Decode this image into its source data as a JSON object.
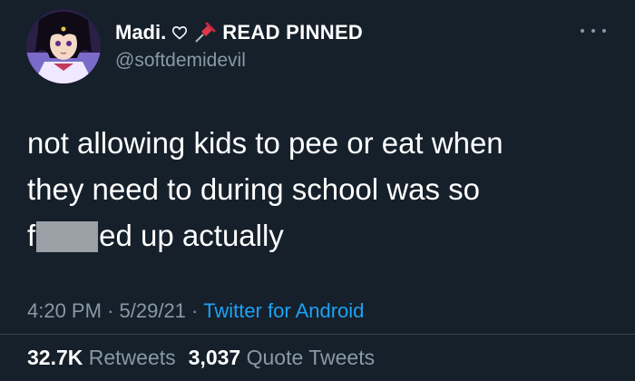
{
  "tweet": {
    "display_name": "Madi.",
    "pinned_label": "READ PINNED",
    "handle": "@softdemidevil",
    "text_line1": "not allowing kids to pee or eat when",
    "text_line2": "they need to during school was so",
    "text_line3_prefix": "f",
    "text_line3_suffix": "ed up actually",
    "time": "4:20 PM",
    "date": "5/29/21",
    "separator": "·",
    "source": "Twitter for Android",
    "retweets_count": "32.7K",
    "retweets_label": "Retweets",
    "quotes_count": "3,037",
    "quotes_label": "Quote Tweets"
  },
  "icons": {
    "heart": "heart-outline-icon",
    "pin": "pushpin-icon",
    "more": "more-horizontal-icon",
    "censor": "censor-block"
  },
  "colors": {
    "background": "#15202b",
    "secondary_text": "#8899a6",
    "link": "#1da1f2",
    "pin": "#e0384b"
  }
}
